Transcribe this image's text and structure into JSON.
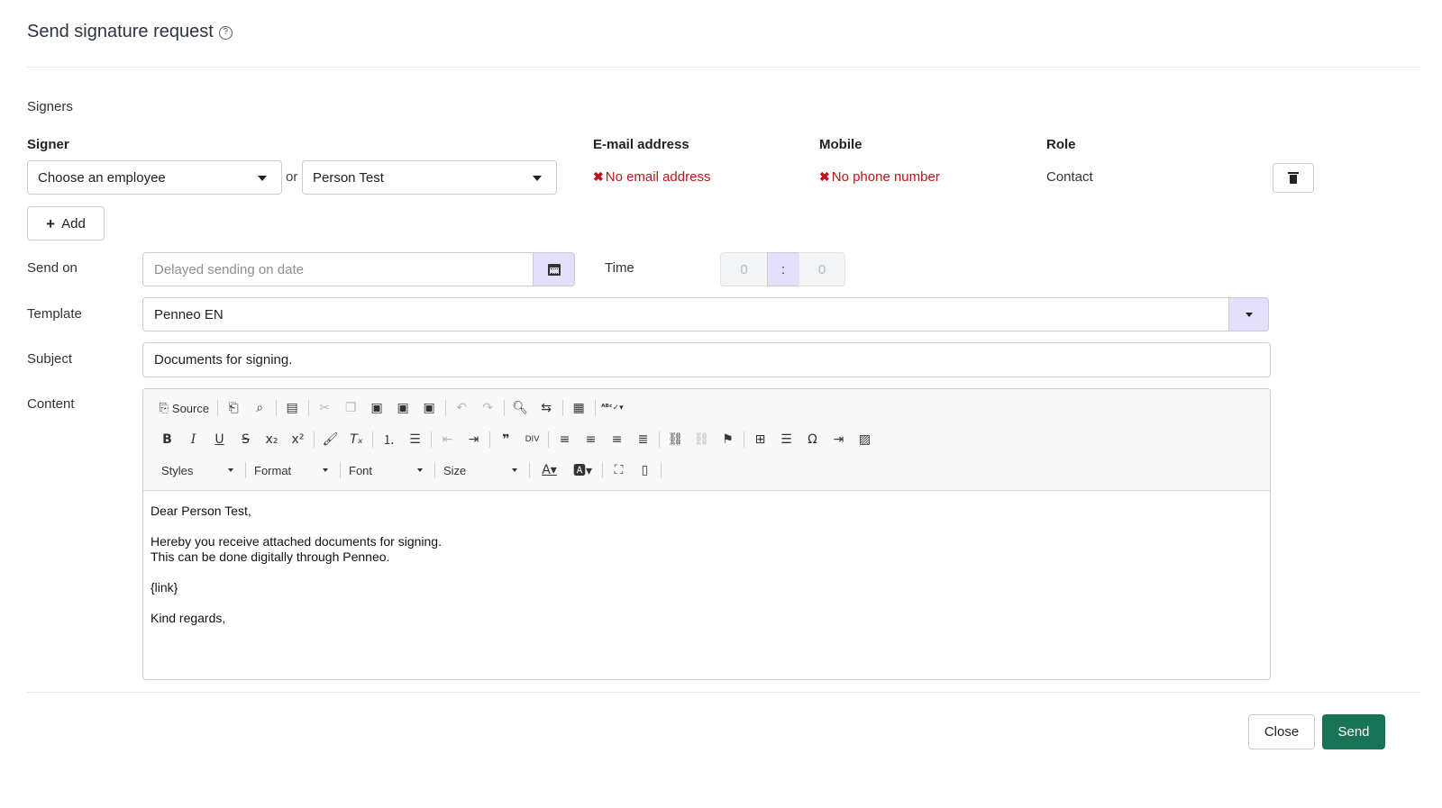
{
  "dialog": {
    "title": "Send signature request"
  },
  "signers": {
    "section_label": "Signers",
    "headers": {
      "signer": "Signer",
      "email": "E-mail address",
      "mobile": "Mobile",
      "role": "Role"
    },
    "row": {
      "employee_select": "Choose an employee",
      "or_label": "or",
      "person_select": "Person Test",
      "email_error": "No email address",
      "mobile_error": "No phone number",
      "role": "Contact"
    },
    "add_label": "Add"
  },
  "form": {
    "send_on": {
      "label": "Send on",
      "placeholder": "Delayed sending on date"
    },
    "time": {
      "label": "Time",
      "hours": "0",
      "separator": ":",
      "minutes": "0"
    },
    "template": {
      "label": "Template",
      "value": "Penneo EN"
    },
    "subject": {
      "label": "Subject",
      "value": "Documents for signing."
    },
    "content": {
      "label": "Content"
    }
  },
  "editor": {
    "source_label": "Source",
    "styles_label": "Styles",
    "format_label": "Format",
    "font_label": "Font",
    "size_label": "Size",
    "body": {
      "greeting": "Dear Person Test,",
      "line1": "Hereby you receive attached documents for signing.",
      "line2": "This can be done digitally through Penneo.",
      "link": "{link}",
      "closing": "Kind regards,"
    }
  },
  "footer": {
    "close_label": "Close",
    "send_label": "Send"
  },
  "colors": {
    "accent_purple": "#e4e0fb",
    "error_red": "#c0121a",
    "send_green": "#197356"
  }
}
